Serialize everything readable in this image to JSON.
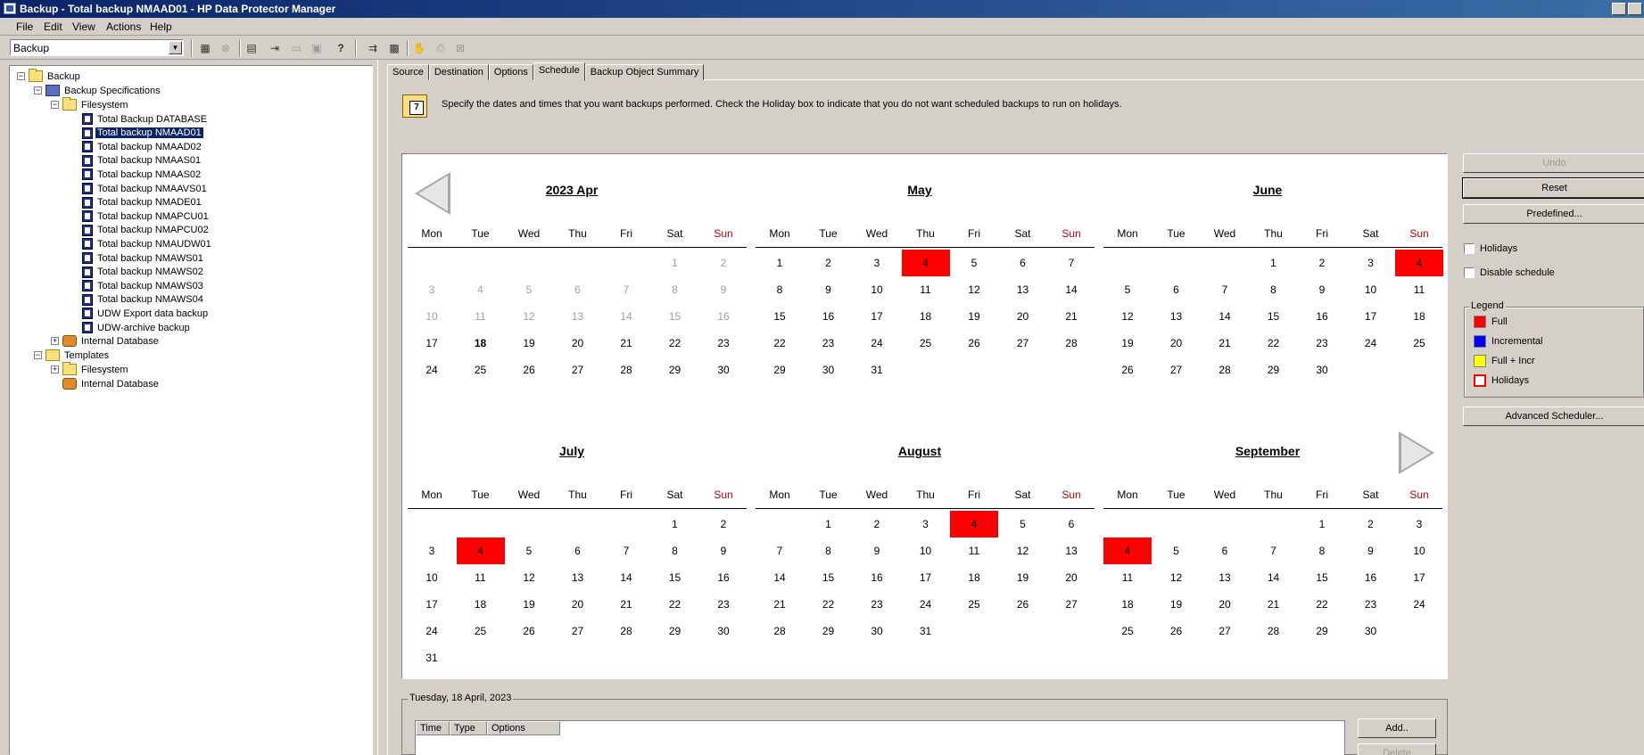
{
  "window": {
    "title": "Backup - Total backup NMAAD01 - HP Data Protector Manager"
  },
  "menu": [
    "File",
    "Edit",
    "View",
    "Actions",
    "Help"
  ],
  "toolbar": {
    "context": "Backup",
    "help_label": "?"
  },
  "tree": {
    "root": "Backup",
    "specs": "Backup Specifications",
    "filesystem": "Filesystem",
    "items": [
      "Total Backup DATABASE",
      "Total backup NMAAD01",
      "Total backup NMAAD02",
      "Total backup NMAAS01",
      "Total backup NMAAS02",
      "Total backup NMAAVS01",
      "Total backup NMADE01",
      "Total backup NMAPCU01",
      "Total backup NMAPCU02",
      "Total backup NMAUDW01",
      "Total backup NMAWS01",
      "Total backup NMAWS02",
      "Total backup NMAWS03",
      "Total backup NMAWS04",
      "UDW Export data backup",
      "UDW-archive backup"
    ],
    "selected_index": 1,
    "internal_db": "Internal Database",
    "templates": "Templates",
    "tmpl_filesystem": "Filesystem",
    "tmpl_internal_db": "Internal Database"
  },
  "tabs": [
    "Source",
    "Destination",
    "Options",
    "Schedule",
    "Backup Object Summary"
  ],
  "active_tab": "Schedule",
  "info": {
    "text": "Specify the dates and times that you want backups performed. Check the Holiday box to indicate that you do not want scheduled backups to run on holidays."
  },
  "weekdays": [
    "Mon",
    "Tue",
    "Wed",
    "Thu",
    "Fri",
    "Sat",
    "Sun"
  ],
  "months": [
    {
      "title": "2023 Apr",
      "start": 5,
      "days": 30,
      "prev_days": 31,
      "full": [],
      "today": 18
    },
    {
      "title": "May",
      "start": 0,
      "days": 31,
      "prev_days": 30,
      "full": [
        4
      ],
      "today": null
    },
    {
      "title": "June",
      "start": 3,
      "days": 30,
      "prev_days": 31,
      "full": [
        4
      ],
      "today": null
    },
    {
      "title": "July",
      "start": 5,
      "days": 31,
      "prev_days": 30,
      "full": [
        4
      ],
      "today": null
    },
    {
      "title": "August",
      "start": 1,
      "days": 31,
      "prev_days": 31,
      "full": [
        4
      ],
      "today": null
    },
    {
      "title": "September",
      "start": 4,
      "days": 30,
      "prev_days": 31,
      "full": [
        4
      ],
      "today": null
    }
  ],
  "side": {
    "undo": "Undo",
    "reset": "Reset",
    "predefined": "Predefined...",
    "holidays": "Holidays",
    "disable": "Disable schedule",
    "advanced": "Advanced Scheduler..."
  },
  "legend": {
    "title": "Legend",
    "items": [
      {
        "label": "Full",
        "color": "#ff0000"
      },
      {
        "label": "Incremental",
        "color": "#0000ff"
      },
      {
        "label": "Full + Incr",
        "color": "#ffff00"
      },
      {
        "label": "Holidays",
        "color": "#ffffff",
        "border": "#ff0000"
      }
    ]
  },
  "day_panel": {
    "title": "Tuesday, 18 April, 2023",
    "columns": [
      "Time",
      "Type",
      "Options"
    ],
    "add": "Add..",
    "delete": "Delete"
  }
}
